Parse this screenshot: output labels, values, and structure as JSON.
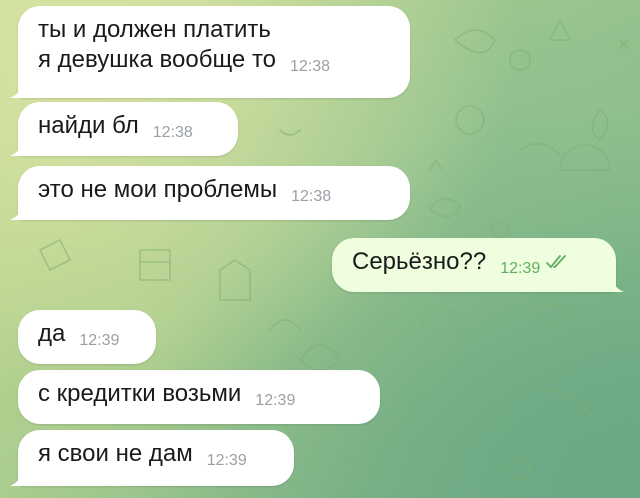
{
  "chat": {
    "messages": [
      {
        "direction": "in",
        "lines": "ты и должен платить\nя девушка вообще то",
        "time": "12:38"
      },
      {
        "direction": "in",
        "lines": "найди бл",
        "time": "12:38"
      },
      {
        "direction": "in",
        "lines": "это не мои проблемы",
        "time": "12:38"
      },
      {
        "direction": "out",
        "lines": "Серьёзно??",
        "time": "12:39",
        "status": "read"
      },
      {
        "direction": "in",
        "lines": "да",
        "time": "12:39"
      },
      {
        "direction": "in",
        "lines": "с кредитки возьми",
        "time": "12:39"
      },
      {
        "direction": "in",
        "lines": "я свои не дам",
        "time": "12:39"
      }
    ]
  },
  "colors": {
    "incoming_bubble": "#ffffff",
    "outgoing_bubble": "#eefedf",
    "read_ticks": "#5fae63"
  },
  "icons": {
    "read_status": "double-check-icon"
  }
}
